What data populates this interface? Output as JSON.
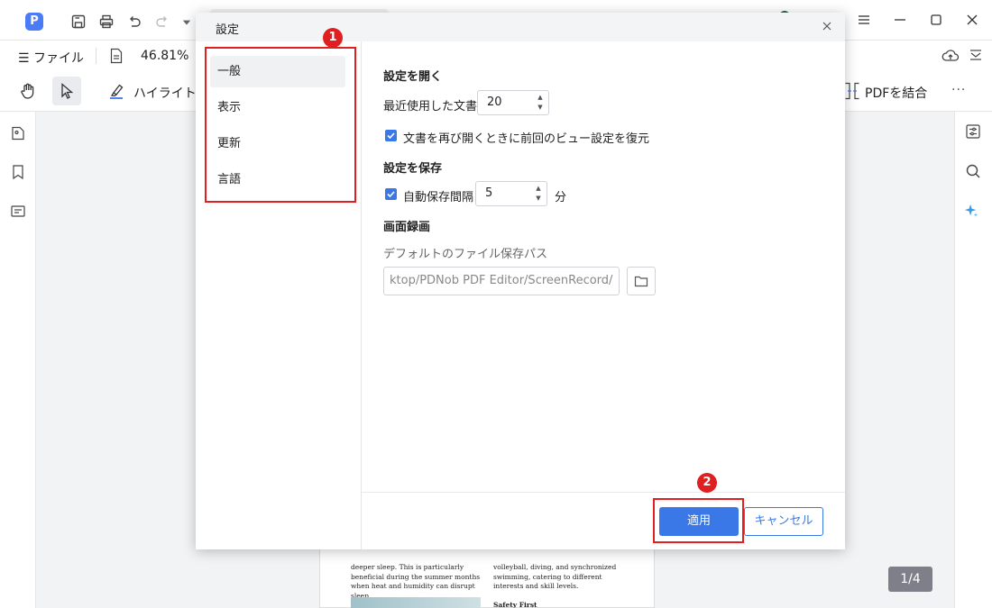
{
  "app": {
    "logo_letter": "P"
  },
  "menu": {
    "file_label": "ファイル",
    "zoom": "46.81%"
  },
  "toolbar": {
    "highlight_label": "ハイライト",
    "merge_label": "PDFを結合",
    "more_label": "···"
  },
  "dialog": {
    "title": "設定",
    "nav": [
      {
        "label": "一般"
      },
      {
        "label": "表示"
      },
      {
        "label": "更新"
      },
      {
        "label": "言語"
      }
    ],
    "open_section": {
      "title": "設定を開く",
      "recent_docs_label": "最近使用した文書",
      "recent_docs_value": "20",
      "restore_view_label": "文書を再び開くときに前回のビュー設定を復元",
      "restore_view_checked": true
    },
    "save_section": {
      "title": "設定を保存",
      "autosave_label": "自動保存間隔",
      "autosave_value": "5",
      "autosave_unit": "分",
      "autosave_checked": true
    },
    "record_section": {
      "title": "画面録画",
      "path_label": "デフォルトのファイル保存パス",
      "path_value": "ktop/PDNob PDF Editor/ScreenRecord/"
    },
    "apply_label": "適用",
    "cancel_label": "キャンセル"
  },
  "annotations": {
    "badge_1": "1",
    "badge_2": "2",
    "color": "#e02020"
  },
  "document": {
    "left_text": "deeper sleep. This is particularly beneficial during the summer months when heat and humidity can disrupt sleep.",
    "right_text": "volleyball, diving, and synchronized swimming, catering to different interests and skill levels.",
    "heading": "Safety First"
  },
  "page_indicator": "1/4",
  "colors": {
    "accent": "#3b78e7",
    "annotation": "#e02020"
  },
  "icons": [
    "save-icon",
    "print-icon",
    "undo-icon",
    "redo-icon",
    "minimize-icon",
    "maximize-icon",
    "close-icon",
    "hand-icon",
    "pointer-icon",
    "highlight-icon",
    "cloud-upload-icon",
    "thumbnail-icon",
    "bookmark-icon",
    "comment-icon",
    "properties-icon",
    "search-icon",
    "ai-sparkle-icon",
    "folder-icon"
  ]
}
